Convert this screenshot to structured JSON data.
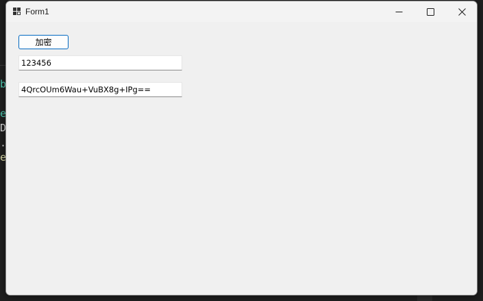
{
  "window": {
    "title": "Form1",
    "icon": "winforms-app-icon",
    "controls": {
      "minimize_icon": "minimize-icon",
      "maximize_icon": "maximize-icon",
      "close_icon": "close-icon"
    }
  },
  "form": {
    "encrypt_button_label": "加密",
    "input_value": "123456",
    "output_value": "4QrcOUm6Wau+VuBX8g+IPg=="
  },
  "background_editor": {
    "glyphs": [
      "b",
      "e",
      "D",
      ".",
      "e"
    ]
  },
  "colors": {
    "button_border": "#0067c0",
    "window_bg": "#f0f0f0",
    "titlebar_bg": "#f3f3f3"
  }
}
